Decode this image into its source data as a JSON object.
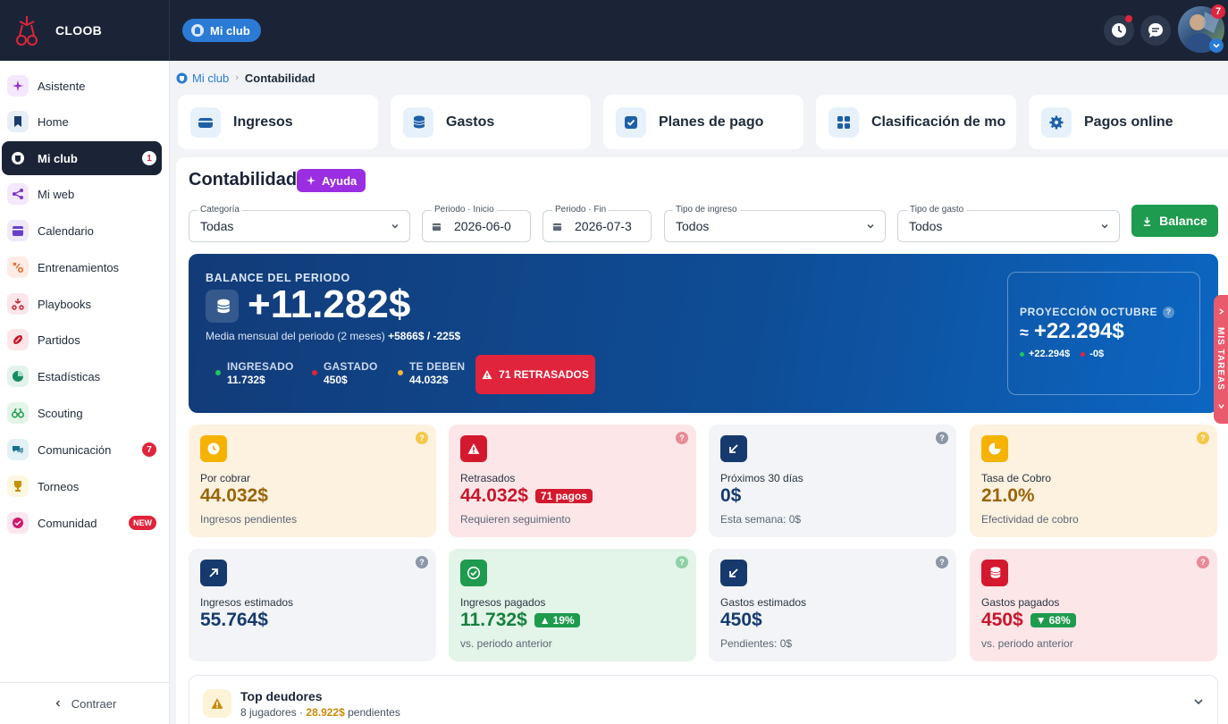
{
  "brand": {
    "name": "CLOOB"
  },
  "topbar": {
    "club_pill": "Mi club",
    "avatar_badge": "7"
  },
  "sidebar": {
    "items": [
      {
        "label": "Asistente",
        "icon": "sparkle-icon"
      },
      {
        "label": "Home",
        "icon": "bookmark-icon"
      },
      {
        "label": "Mi club",
        "icon": "club-icon",
        "badge": "1"
      },
      {
        "label": "Mi web",
        "icon": "share-icon"
      },
      {
        "label": "Calendario",
        "icon": "calendar-icon"
      },
      {
        "label": "Entrenamientos",
        "icon": "drill-icon"
      },
      {
        "label": "Playbooks",
        "icon": "playbook-icon"
      },
      {
        "label": "Partidos",
        "icon": "ball-icon"
      },
      {
        "label": "Estadísticas",
        "icon": "chart-pie-icon"
      },
      {
        "label": "Scouting",
        "icon": "binoculars-icon"
      },
      {
        "label": "Comunicación",
        "icon": "chat-icon",
        "badge": "7"
      },
      {
        "label": "Torneos",
        "icon": "trophy-icon"
      },
      {
        "label": "Comunidad",
        "icon": "community-icon",
        "badge": "NEW"
      }
    ],
    "collapse_label": "Contraer"
  },
  "breadcrumb": {
    "parent": "Mi club",
    "current": "Contabilidad"
  },
  "tabs": [
    {
      "label": "Ingresos",
      "icon": "wallet-icon"
    },
    {
      "label": "Gastos",
      "icon": "coins-icon"
    },
    {
      "label": "Planes de pago",
      "icon": "checkbox-icon"
    },
    {
      "label": "Clasificación de mo",
      "icon": "grid-icon"
    },
    {
      "label": "Pagos online",
      "icon": "gear-icon"
    }
  ],
  "page": {
    "title": "Contabilidad",
    "help_label": "Ayuda"
  },
  "filters": {
    "categoria": {
      "label": "Categoría",
      "value": "Todas"
    },
    "inicio": {
      "label": "Periodo · Inicio",
      "value": "2026-06-0"
    },
    "fin": {
      "label": "Periodo · Fin",
      "value": "2026-07-3"
    },
    "tipo_ingreso": {
      "label": "Tipo de ingreso",
      "value": "Todos"
    },
    "tipo_gasto": {
      "label": "Tipo de gasto",
      "value": "Todos"
    },
    "balance_button": "Balance"
  },
  "banner": {
    "title": "BALANCE DEL PERIODO",
    "amount": "+11.282$",
    "sub_prefix": "Media mensual del periodo (2 meses)",
    "sub_values": "+5866$ / -225$",
    "stats": [
      {
        "label": "INGRESADO",
        "value": "11.732$",
        "color": "#22c55e"
      },
      {
        "label": "GASTADO",
        "value": "450$",
        "color": "#e0243b"
      },
      {
        "label": "TE DEBEN",
        "value": "44.032$",
        "color": "#f5b82e"
      }
    ],
    "late_label": "71 RETRASADOS",
    "projection": {
      "title": "PROYECCIÓN OCTUBRE",
      "amount": "+22.294$",
      "positive": "+22.294$",
      "negative": "-0$"
    }
  },
  "tasks_tab": "MIS TAREAS",
  "cards": [
    {
      "label": "Por cobrar",
      "value": "44.032$",
      "sub": "Ingresos pendientes",
      "bg": "#fdf1e0",
      "icon_bg": "#f5b300",
      "value_color": "#9a6406",
      "q_color": "#f5c84a",
      "icon": "clock-icon"
    },
    {
      "label": "Retrasados",
      "value": "44.032$",
      "pill": "71 pagos",
      "sub": "Requieren seguimiento",
      "bg": "#fce6e8",
      "icon_bg": "#d4182d",
      "value_color": "#c8162a",
      "q_color": "#e88b96",
      "pill_color": "#d4182d",
      "icon": "warning-icon"
    },
    {
      "label": "Próximos 30 días",
      "value": "0$",
      "sub": "Esta semana: 0$",
      "bg": "#f2f4f7",
      "icon_bg": "#173a6e",
      "value_color": "#173a6e",
      "q_color": "#8c97a8",
      "icon": "arrow-down-left-icon"
    },
    {
      "label": "Tasa de Cobro",
      "value": "21.0%",
      "sub": "Efectividad de cobro",
      "bg": "#fdf1e0",
      "icon_bg": "#f5b300",
      "value_color": "#9a6406",
      "q_color": "#f5c84a",
      "icon": "pie-icon"
    },
    {
      "label": "Ingresos estimados",
      "value": "55.764$",
      "sub": "",
      "bg": "#f2f4f7",
      "icon_bg": "#173a6e",
      "value_color": "#173a6e",
      "q_color": "#8c97a8",
      "icon": "arrow-up-right-icon"
    },
    {
      "label": "Ingresos pagados",
      "value": "11.732$",
      "pill": "19%",
      "pill_dir": "up",
      "sub": "vs. periodo anterior",
      "bg": "#e3f4e8",
      "icon_bg": "#1e9b4e",
      "value_color": "#17803f",
      "q_color": "#8fd1a6",
      "pill_color": "#1e9b4e",
      "icon": "check-circle-icon"
    },
    {
      "label": "Gastos estimados",
      "value": "450$",
      "sub": "Pendientes: 0$",
      "bg": "#f2f4f7",
      "icon_bg": "#173a6e",
      "value_color": "#173a6e",
      "q_color": "#8c97a8",
      "icon": "arrow-down-left-icon"
    },
    {
      "label": "Gastos pagados",
      "value": "450$",
      "pill": "68%",
      "pill_dir": "down",
      "sub": "vs. periodo anterior",
      "bg": "#fce6e8",
      "icon_bg": "#d4182d",
      "value_color": "#c8162a",
      "q_color": "#e88b96",
      "pill_color": "#1e9b4e",
      "icon": "coins-icon"
    }
  ],
  "deudores": {
    "title": "Top deudores",
    "sub_prefix": "8 jugadores · ",
    "amount": "28.922$",
    "sub_suffix": " pendientes"
  }
}
